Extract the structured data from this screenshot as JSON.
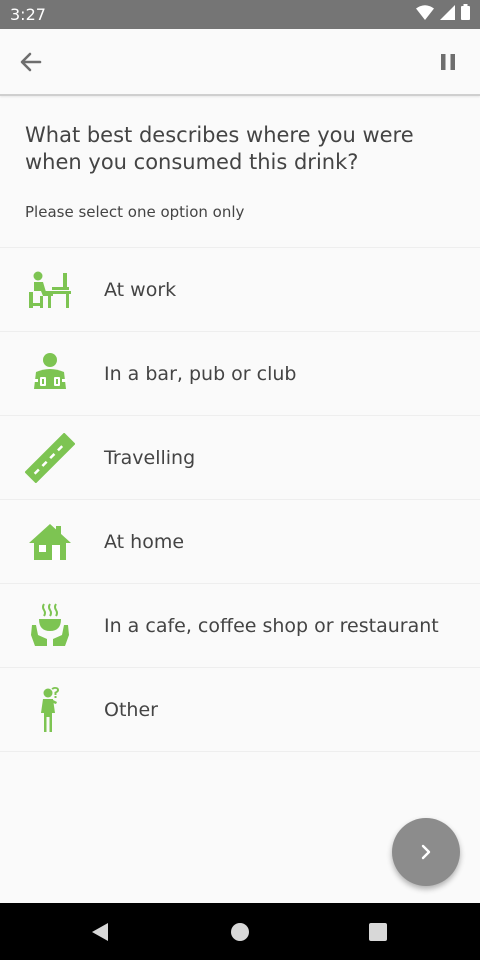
{
  "status_bar": {
    "time": "3:27",
    "icons": [
      "wifi-icon",
      "signal-icon",
      "battery-icon"
    ]
  },
  "app_bar": {
    "back_icon": "arrow-back-icon",
    "pause_icon": "pause-icon"
  },
  "question": {
    "text": "What best describes where you were when you consumed this drink?",
    "instruction": "Please select one option only"
  },
  "options": [
    {
      "label": "At work",
      "icon": "work-desk-icon"
    },
    {
      "label": "In a bar, pub or club",
      "icon": "bar-icon"
    },
    {
      "label": "Travelling",
      "icon": "road-icon"
    },
    {
      "label": "At home",
      "icon": "home-icon"
    },
    {
      "label": "In a cafe, coffee shop or restaurant",
      "icon": "cafe-icon"
    },
    {
      "label": "Other",
      "icon": "person-question-icon"
    }
  ],
  "fab": {
    "icon": "chevron-right-icon"
  },
  "nav_bar": {
    "icons": [
      "nav-back-icon",
      "nav-home-icon",
      "nav-recents-icon"
    ]
  },
  "colors": {
    "accent": "#7dc452",
    "status_bar": "#757575",
    "fab": "#8c8c8c",
    "text": "#444444"
  }
}
